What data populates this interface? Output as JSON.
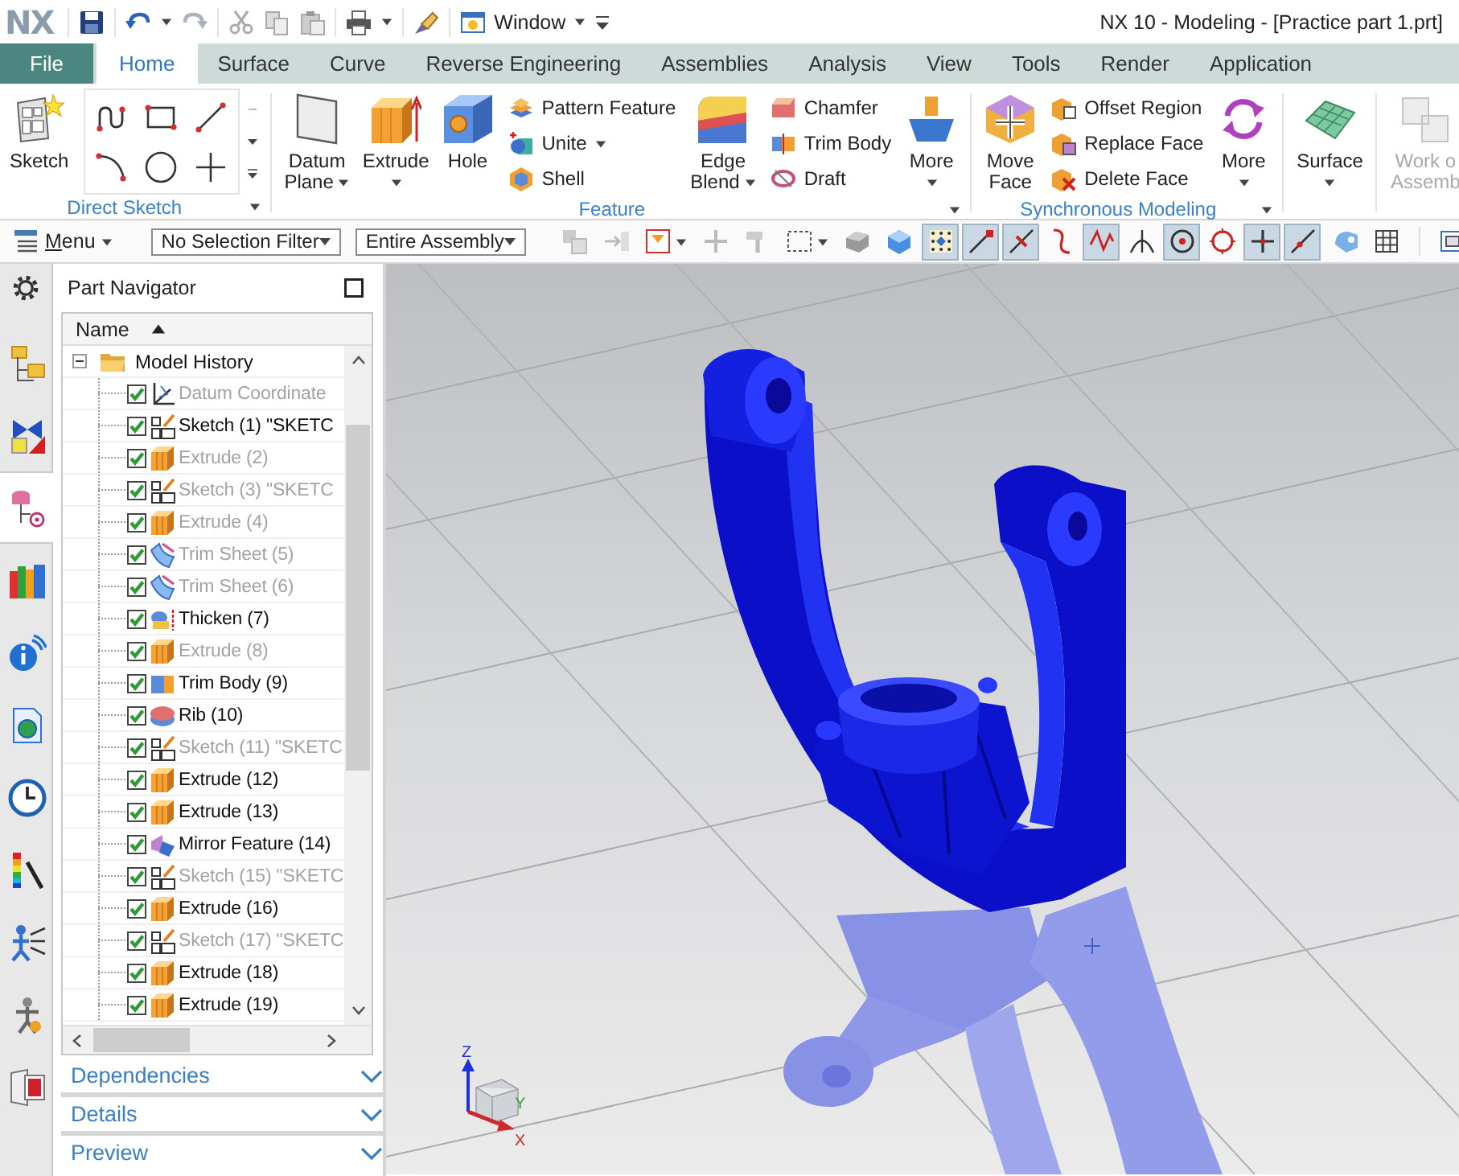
{
  "title_bar": {
    "logo": "NX",
    "window_menu": "Window",
    "title": "NX 10 - Modeling - [Practice part 1.prt]"
  },
  "tabs": [
    {
      "label": "File",
      "kind": "file",
      "selected": false
    },
    {
      "label": "Home",
      "kind": "tab",
      "selected": true
    },
    {
      "label": "Surface",
      "kind": "tab",
      "selected": false
    },
    {
      "label": "Curve",
      "kind": "tab",
      "selected": false
    },
    {
      "label": "Reverse Engineering",
      "kind": "tab",
      "selected": false
    },
    {
      "label": "Assemblies",
      "kind": "tab",
      "selected": false
    },
    {
      "label": "Analysis",
      "kind": "tab",
      "selected": false
    },
    {
      "label": "View",
      "kind": "tab",
      "selected": false
    },
    {
      "label": "Tools",
      "kind": "tab",
      "selected": false
    },
    {
      "label": "Render",
      "kind": "tab",
      "selected": false
    },
    {
      "label": "Application",
      "kind": "tab",
      "selected": false
    }
  ],
  "ribbon": {
    "groups": [
      {
        "label": "Direct Sketch",
        "menu": true,
        "items": [
          {
            "kind": "sketch",
            "lines": [
              "Sketch"
            ],
            "dropdown": false,
            "disabled": false
          },
          {
            "kind": "gallery"
          }
        ]
      },
      {
        "label": "Feature",
        "menu": true,
        "items": [
          {
            "kind": "datum",
            "lines": [
              "Datum",
              "Plane"
            ],
            "dropdown": true,
            "disabled": false
          },
          {
            "kind": "extrude",
            "lines": [
              "Extrude"
            ],
            "dropdown": true,
            "disabled": false
          },
          {
            "kind": "hole",
            "lines": [
              "Hole"
            ],
            "dropdown": false,
            "disabled": false
          },
          {
            "kind": "stack",
            "entries": [
              {
                "kind": "pattern",
                "label": "Pattern Feature",
                "dropdown": false
              },
              {
                "kind": "unite",
                "label": "Unite",
                "dropdown": true
              },
              {
                "kind": "shell",
                "label": "Shell",
                "dropdown": false
              }
            ]
          },
          {
            "kind": "blend",
            "lines": [
              "Edge",
              "Blend"
            ],
            "dropdown": true,
            "disabled": false
          },
          {
            "kind": "stack",
            "entries": [
              {
                "kind": "chamfer",
                "label": "Chamfer",
                "dropdown": false
              },
              {
                "kind": "trimbody",
                "label": "Trim Body",
                "dropdown": false
              },
              {
                "kind": "draft",
                "label": "Draft",
                "dropdown": false
              }
            ]
          },
          {
            "kind": "more",
            "lines": [
              "More"
            ],
            "dropdown": true,
            "disabled": false
          }
        ]
      },
      {
        "label": "Synchronous Modeling",
        "menu": true,
        "items": [
          {
            "kind": "moveface",
            "lines": [
              "Move",
              "Face"
            ],
            "dropdown": false,
            "disabled": false
          },
          {
            "kind": "stack",
            "entries": [
              {
                "kind": "offset",
                "label": "Offset Region",
                "dropdown": false
              },
              {
                "kind": "replace",
                "label": "Replace Face",
                "dropdown": false
              },
              {
                "kind": "delete",
                "label": "Delete Face",
                "dropdown": false
              }
            ]
          },
          {
            "kind": "moresync",
            "lines": [
              "More"
            ],
            "dropdown": true,
            "disabled": false
          }
        ]
      },
      {
        "menu": false,
        "items": [
          {
            "kind": "surface",
            "lines": [
              "Surface"
            ],
            "dropdown": true,
            "disabled": false
          }
        ]
      },
      {
        "menu": false,
        "items": [
          {
            "kind": "assembly",
            "lines": [
              "Work o",
              "Assemb"
            ],
            "dropdown": false,
            "disabled": true
          }
        ]
      }
    ]
  },
  "toolbar": {
    "menu": "Menu",
    "selection_filter": "No Selection Filter",
    "assembly_scope": "Entire Assembly",
    "snap_buttons": [
      {
        "kind": "grid",
        "on": true
      },
      {
        "kind": "endpoint",
        "on": true
      },
      {
        "kind": "midpoint",
        "on": true
      },
      {
        "kind": "curve",
        "on": false
      },
      {
        "kind": "control",
        "on": true
      },
      {
        "kind": "intersect",
        "on": false
      },
      {
        "kind": "center",
        "on": true
      },
      {
        "kind": "quadrant",
        "on": false
      },
      {
        "kind": "existing",
        "on": true
      },
      {
        "kind": "onpoint",
        "on": true
      }
    ]
  },
  "nav_rail": [
    {
      "kind": "assembly",
      "selected": false
    },
    {
      "kind": "constraint",
      "selected": false
    },
    {
      "kind": "part",
      "selected": true
    },
    {
      "kind": "reuse",
      "selected": false
    },
    {
      "kind": "hd3d",
      "selected": false
    },
    {
      "kind": "browser",
      "selected": false
    },
    {
      "kind": "history",
      "selected": false
    },
    {
      "kind": "materials",
      "selected": false
    },
    {
      "kind": "process",
      "selected": false
    },
    {
      "kind": "roles",
      "selected": false
    },
    {
      "kind": "palette",
      "selected": false
    }
  ],
  "part_navigator": {
    "title": "Part Navigator",
    "column": "Name",
    "root": {
      "label": "Model History",
      "expanded": true,
      "children": [
        {
          "kind": "datum",
          "label": "Datum Coordinate",
          "checked": true,
          "dimmed": true
        },
        {
          "kind": "sketch",
          "label": "Sketch (1) \"SKETC",
          "checked": true,
          "dimmed": false
        },
        {
          "kind": "extrude",
          "label": "Extrude (2)",
          "checked": true,
          "dimmed": true
        },
        {
          "kind": "sketch",
          "label": "Sketch (3) \"SKETC",
          "checked": true,
          "dimmed": true
        },
        {
          "kind": "extrude",
          "label": "Extrude (4)",
          "checked": true,
          "dimmed": true
        },
        {
          "kind": "trimsheet",
          "label": "Trim Sheet (5)",
          "checked": true,
          "dimmed": true
        },
        {
          "kind": "trimsheet",
          "label": "Trim Sheet (6)",
          "checked": true,
          "dimmed": true
        },
        {
          "kind": "thicken",
          "label": "Thicken (7)",
          "checked": true,
          "dimmed": false
        },
        {
          "kind": "extrude",
          "label": "Extrude (8)",
          "checked": true,
          "dimmed": true
        },
        {
          "kind": "trimbody",
          "label": "Trim Body (9)",
          "checked": true,
          "dimmed": false
        },
        {
          "kind": "rib",
          "label": "Rib (10)",
          "checked": true,
          "dimmed": false
        },
        {
          "kind": "sketch",
          "label": "Sketch (11) \"SKETC",
          "checked": true,
          "dimmed": true
        },
        {
          "kind": "extrude",
          "label": "Extrude (12)",
          "checked": true,
          "dimmed": false
        },
        {
          "kind": "extrude",
          "label": "Extrude (13)",
          "checked": true,
          "dimmed": false
        },
        {
          "kind": "mirror",
          "label": "Mirror Feature (14)",
          "checked": true,
          "dimmed": false
        },
        {
          "kind": "sketch",
          "label": "Sketch (15) \"SKETC",
          "checked": true,
          "dimmed": true
        },
        {
          "kind": "extrude",
          "label": "Extrude (16)",
          "checked": true,
          "dimmed": false
        },
        {
          "kind": "sketch",
          "label": "Sketch (17) \"SKETC",
          "checked": true,
          "dimmed": true
        },
        {
          "kind": "extrude",
          "label": "Extrude (18)",
          "checked": true,
          "dimmed": false
        },
        {
          "kind": "extrude",
          "label": "Extrude (19)",
          "checked": true,
          "dimmed": false
        }
      ]
    },
    "sections": [
      {
        "label": "Dependencies",
        "expanded": false
      },
      {
        "label": "Details",
        "expanded": false
      },
      {
        "label": "Preview",
        "expanded": false
      }
    ]
  },
  "view": {
    "triad": {
      "x": "X",
      "y": "Y",
      "z": "Z"
    }
  }
}
